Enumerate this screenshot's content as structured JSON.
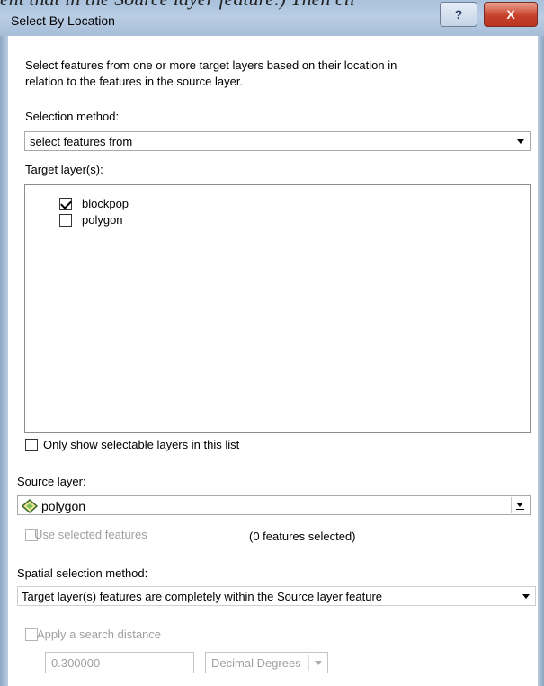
{
  "background_caption": "ent that in the Source layer feature.) Then cli",
  "window": {
    "title": "Select By Location",
    "help_label": "?",
    "close_label": "X"
  },
  "description": {
    "line1": "Select features from one or more target layers based on their location in",
    "line2": "relation to the features in the source layer."
  },
  "selection_method": {
    "label": "Selection method:",
    "value": "select features from"
  },
  "target_layers": {
    "label": "Target layer(s):",
    "items": [
      {
        "label": "blockpop",
        "checked": true
      },
      {
        "label": "polygon",
        "checked": false
      }
    ]
  },
  "only_selectable": {
    "label": "Only show selectable layers in this list",
    "checked": false
  },
  "source_layer": {
    "label": "Source layer:",
    "value": "polygon",
    "icon": "polygon-layer-icon"
  },
  "use_selected": {
    "label": "Use selected features",
    "checked": false,
    "enabled": false,
    "count_text": "(0 features selected)"
  },
  "spatial_method": {
    "label": "Spatial selection method:",
    "value": "Target layer(s) features are completely within the Source layer feature"
  },
  "search_distance": {
    "label": "Apply a search distance",
    "checked": false,
    "enabled": false,
    "value": "0.300000",
    "unit": "Decimal Degrees"
  },
  "colors": {
    "title_bar": "#a9c1dc",
    "close_button": "#c7412b",
    "disabled_text": "#a0a0a0"
  }
}
